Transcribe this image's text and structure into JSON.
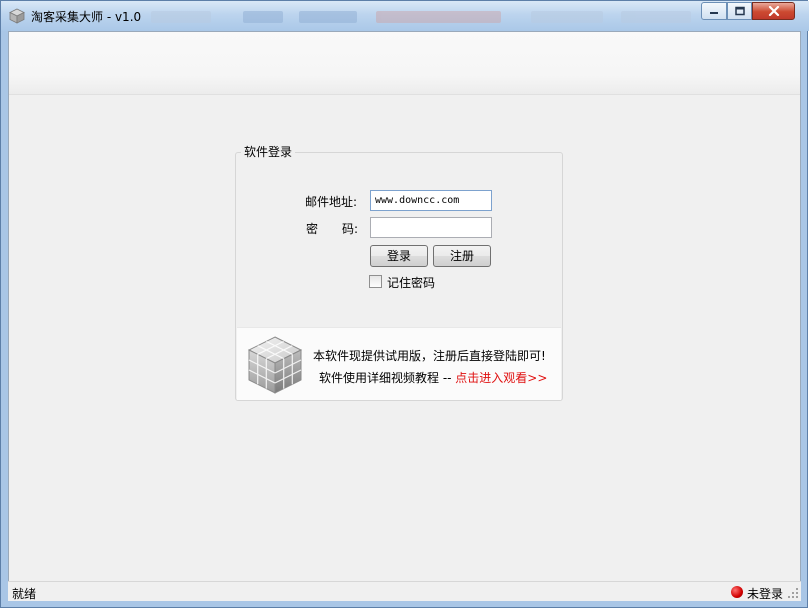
{
  "window": {
    "title": "淘客采集大师 - v1.0",
    "controls": {
      "minimize": "minimize",
      "maximize": "maximize",
      "close": "close"
    }
  },
  "login_group": {
    "legend": "软件登录",
    "email_label": "邮件地址:",
    "email_value": "www.downcc.com",
    "password_label": "密　　码:",
    "password_value": "",
    "login_button": "登录",
    "register_button": "注册",
    "remember_label": "记住密码",
    "remember_checked": false
  },
  "promo": {
    "line1": "本软件现提供试用版，注册后直接登陆即可!",
    "line2_prefix": "软件使用详细视频教程 -- ",
    "line2_link": "点击进入观看>>"
  },
  "statusbar": {
    "left_text": "就绪",
    "login_status": "未登录",
    "status_color": "#d10000"
  },
  "icons": {
    "app": "cube-app-icon",
    "promo": "cube-icon"
  }
}
